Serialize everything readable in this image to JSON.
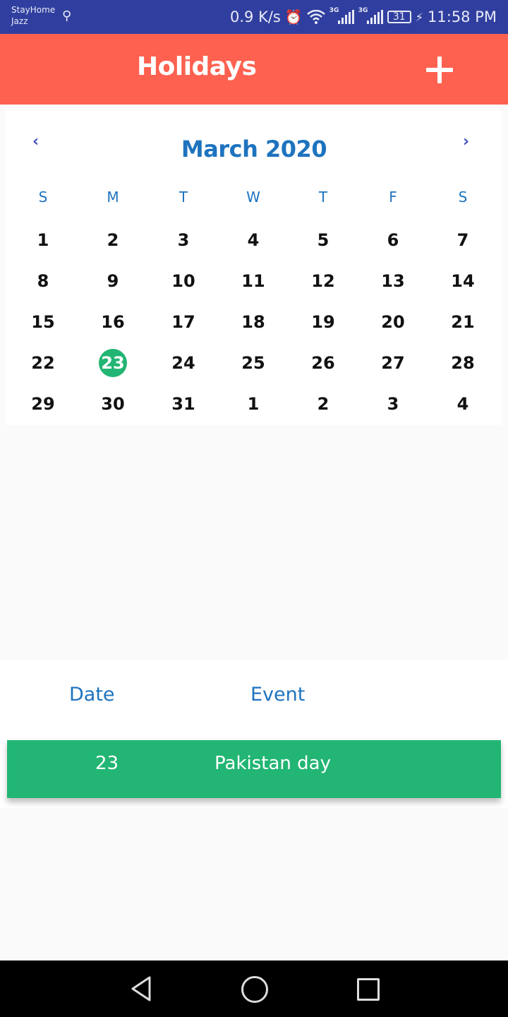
{
  "status_bar": {
    "carrier_line1": "StayHome",
    "carrier_line2": "Jazz",
    "usb_icon": "usb-icon",
    "net_speed": "0.9 K/s",
    "signal_tag_1": "3G",
    "signal_tag_2": "3G",
    "battery": "31",
    "time": "11:58 PM"
  },
  "app_bar": {
    "title": "Holidays",
    "add_icon": "plus-icon"
  },
  "calendar": {
    "prev_label": "‹",
    "next_label": "›",
    "month_title": "March 2020",
    "weekdays": [
      "S",
      "M",
      "T",
      "W",
      "T",
      "F",
      "S"
    ],
    "weeks": [
      [
        "1",
        "2",
        "3",
        "4",
        "5",
        "6",
        "7"
      ],
      [
        "8",
        "9",
        "10",
        "11",
        "12",
        "13",
        "14"
      ],
      [
        "15",
        "16",
        "17",
        "18",
        "19",
        "20",
        "21"
      ],
      [
        "22",
        "23",
        "24",
        "25",
        "26",
        "27",
        "28"
      ],
      [
        "29",
        "30",
        "31",
        "1",
        "2",
        "3",
        "4"
      ]
    ],
    "selected_day": "23"
  },
  "holidays": {
    "header_date": "Date",
    "header_event": "Event",
    "rows": [
      {
        "date": "23",
        "event": "Pakistan day"
      }
    ]
  },
  "colors": {
    "status_bar": "#303f9f",
    "app_bar": "#fe6150",
    "accent_blue": "#1e73be",
    "selected_green": "#22b573"
  },
  "nav_bar": {
    "back_icon": "back-triangle-icon",
    "home_icon": "home-circle-icon",
    "recents_icon": "recents-square-icon"
  }
}
